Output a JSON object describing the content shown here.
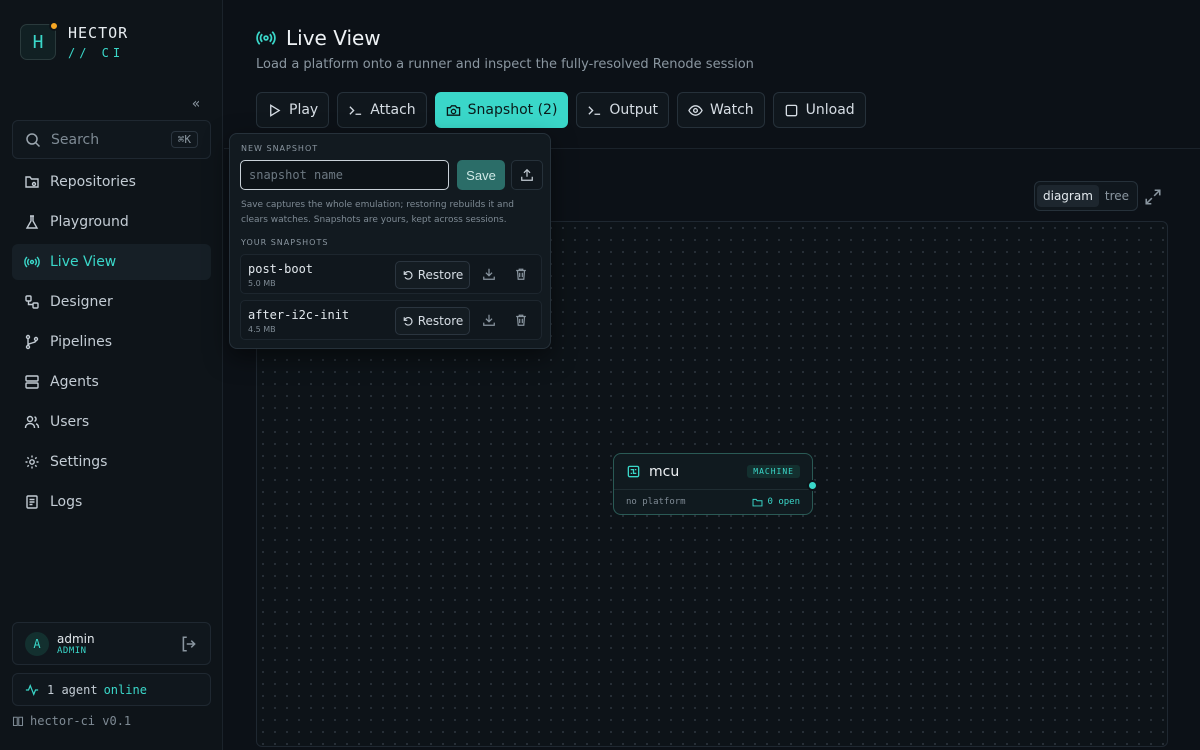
{
  "brand": {
    "initial": "H",
    "name": "HECTOR",
    "sub": "// CI"
  },
  "sidebar": {
    "collapse_glyph": "«",
    "search": {
      "placeholder": "Search",
      "shortcut": "⌘K"
    },
    "items": [
      {
        "label": "Repositories",
        "icon": "repositories-icon"
      },
      {
        "label": "Playground",
        "icon": "flask-icon"
      },
      {
        "label": "Live View",
        "icon": "broadcast-icon",
        "active": true
      },
      {
        "label": "Designer",
        "icon": "designer-icon"
      },
      {
        "label": "Pipelines",
        "icon": "git-branch-icon"
      },
      {
        "label": "Agents",
        "icon": "server-icon"
      },
      {
        "label": "Users",
        "icon": "users-icon"
      },
      {
        "label": "Settings",
        "icon": "gear-icon"
      },
      {
        "label": "Logs",
        "icon": "logs-icon"
      }
    ],
    "user": {
      "initial": "A",
      "name": "admin",
      "role": "ADMIN"
    },
    "agents": {
      "count_text": "1 agent",
      "status": "online"
    },
    "version": "hector-ci v0.1"
  },
  "main": {
    "title": "Live View",
    "subtitle": "Load a platform onto a runner and inspect the fully-resolved Renode session",
    "toolbar": {
      "play": "Play",
      "attach": "Attach",
      "snapshot": "Snapshot (2)",
      "output": "Output",
      "watch": "Watch",
      "unload": "Unload"
    },
    "view_toggle": {
      "diagram": "diagram",
      "tree": "tree",
      "active": "diagram"
    },
    "node": {
      "name": "mcu",
      "badge": "MACHINE",
      "platform": "no platform",
      "open": "0 open"
    }
  },
  "snapshot_popover": {
    "new_label": "NEW SNAPSHOT",
    "input_placeholder": "snapshot name",
    "input_value": "",
    "save": "Save",
    "help": "Save captures the whole emulation; restoring rebuilds it and clears watches. Snapshots are yours, kept across sessions.",
    "list_label": "YOUR SNAPSHOTS",
    "restore_label": "Restore",
    "snapshots": [
      {
        "name": "post-boot",
        "size": "5.0 MB"
      },
      {
        "name": "after-i2c-init",
        "size": "4.5 MB"
      }
    ]
  },
  "colors": {
    "accent": "#3ad7c9",
    "background": "#0c1117",
    "sidebar": "#0e1419",
    "brand_dot": "#f5a623"
  }
}
